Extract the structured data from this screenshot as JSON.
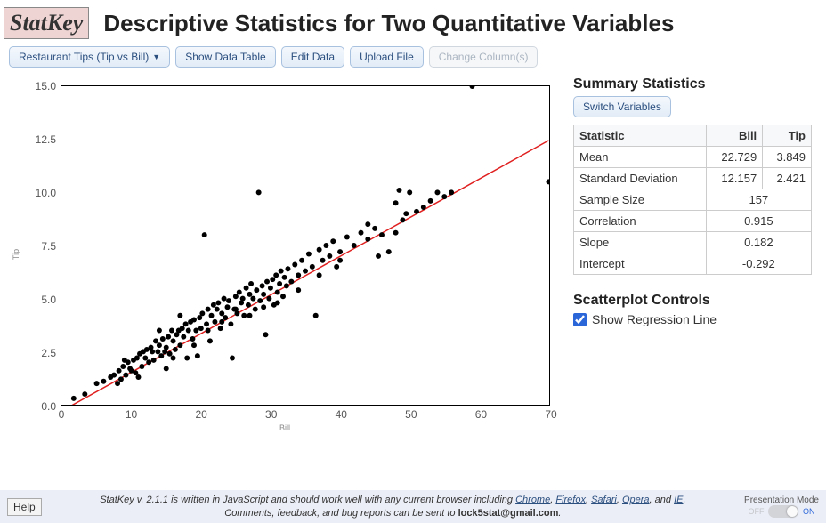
{
  "header": {
    "logo": "StatKey",
    "title": "Descriptive Statistics for Two Quantitative Variables"
  },
  "toolbar": {
    "dataset": "Restaurant Tips (Tip vs Bill)",
    "show_table": "Show Data Table",
    "edit": "Edit Data",
    "upload": "Upload File",
    "change_cols": "Change Column(s)"
  },
  "summary": {
    "title": "Summary Statistics",
    "switch": "Switch Variables",
    "head_stat": "Statistic",
    "head_x": "Bill",
    "head_y": "Tip",
    "rows": {
      "mean_label": "Mean",
      "mean_x": "22.729",
      "mean_y": "3.849",
      "sd_label": "Standard Deviation",
      "sd_x": "12.157",
      "sd_y": "2.421",
      "n_label": "Sample Size",
      "n": "157",
      "r_label": "Correlation",
      "r": "0.915",
      "slope_label": "Slope",
      "slope": "0.182",
      "int_label": "Intercept",
      "int": "-0.292"
    }
  },
  "controls": {
    "title": "Scatterplot Controls",
    "show_reg": "Show Regression Line",
    "show_reg_checked": true
  },
  "footer": {
    "help": "Help",
    "line1a": "StatKey v. 2.1.1 is written in JavaScript and should work well with any current browser including ",
    "chrome": "Chrome",
    "firefox": "Firefox",
    "safari": "Safari",
    "opera": "Opera",
    "ie": "IE",
    "line1b": ".",
    "line2a": "Comments, feedback, and bug reports can be sent to ",
    "email": "lock5stat@gmail.com",
    "line2b": ".",
    "presentation": "Presentation Mode",
    "off": "OFF",
    "on": "ON"
  },
  "chart_data": {
    "type": "scatter",
    "xlabel": "Bill",
    "ylabel": "Tip",
    "xlim": [
      0,
      70
    ],
    "ylim": [
      0,
      15
    ],
    "xticks": [
      0,
      10,
      20,
      30,
      40,
      50,
      60,
      70
    ],
    "yticks": [
      0.0,
      2.5,
      5.0,
      7.5,
      10.0,
      12.5,
      15.0
    ],
    "regression": {
      "slope": 0.182,
      "intercept": -0.292,
      "color": "#e02020"
    },
    "points": [
      [
        1.7,
        0.3
      ],
      [
        3.3,
        0.5
      ],
      [
        5.0,
        1.0
      ],
      [
        6.0,
        1.1
      ],
      [
        7.0,
        1.3
      ],
      [
        7.5,
        1.4
      ],
      [
        8.0,
        1.0
      ],
      [
        8.2,
        1.6
      ],
      [
        8.5,
        1.2
      ],
      [
        8.8,
        1.8
      ],
      [
        9.0,
        2.1
      ],
      [
        9.2,
        1.4
      ],
      [
        9.5,
        2.0
      ],
      [
        9.8,
        1.7
      ],
      [
        10.0,
        1.6
      ],
      [
        10.3,
        2.1
      ],
      [
        10.6,
        1.5
      ],
      [
        10.8,
        2.2
      ],
      [
        11.0,
        1.3
      ],
      [
        11.2,
        2.4
      ],
      [
        11.5,
        1.8
      ],
      [
        11.7,
        2.5
      ],
      [
        12.0,
        2.2
      ],
      [
        12.2,
        2.6
      ],
      [
        12.5,
        2.0
      ],
      [
        12.8,
        2.7
      ],
      [
        13.0,
        2.5
      ],
      [
        13.2,
        2.1
      ],
      [
        13.5,
        3.0
      ],
      [
        13.8,
        2.5
      ],
      [
        14.0,
        2.8
      ],
      [
        14.3,
        2.3
      ],
      [
        14.5,
        3.1
      ],
      [
        14.8,
        2.5
      ],
      [
        15.0,
        2.7
      ],
      [
        15.3,
        3.2
      ],
      [
        15.5,
        2.4
      ],
      [
        15.8,
        3.5
      ],
      [
        16.0,
        3.0
      ],
      [
        16.3,
        2.6
      ],
      [
        16.5,
        3.3
      ],
      [
        16.8,
        3.5
      ],
      [
        17.0,
        2.8
      ],
      [
        17.3,
        3.6
      ],
      [
        17.5,
        3.2
      ],
      [
        17.8,
        3.8
      ],
      [
        18.0,
        2.2
      ],
      [
        18.2,
        3.5
      ],
      [
        18.5,
        3.9
      ],
      [
        18.8,
        3.1
      ],
      [
        19.0,
        4.0
      ],
      [
        19.3,
        3.5
      ],
      [
        19.5,
        2.3
      ],
      [
        19.8,
        4.1
      ],
      [
        20.0,
        3.6
      ],
      [
        20.2,
        4.3
      ],
      [
        20.5,
        8.0
      ],
      [
        20.8,
        3.8
      ],
      [
        21.0,
        4.5
      ],
      [
        21.3,
        3.0
      ],
      [
        21.5,
        4.2
      ],
      [
        21.8,
        4.7
      ],
      [
        22.0,
        3.9
      ],
      [
        22.3,
        4.5
      ],
      [
        22.5,
        4.8
      ],
      [
        22.8,
        3.6
      ],
      [
        23.0,
        4.3
      ],
      [
        23.3,
        5.0
      ],
      [
        23.5,
        4.1
      ],
      [
        23.8,
        4.6
      ],
      [
        24.0,
        4.9
      ],
      [
        24.3,
        3.8
      ],
      [
        24.5,
        2.2
      ],
      [
        24.8,
        4.5
      ],
      [
        25.0,
        5.1
      ],
      [
        25.2,
        4.3
      ],
      [
        25.5,
        5.3
      ],
      [
        25.8,
        4.8
      ],
      [
        26.0,
        5.0
      ],
      [
        26.2,
        4.2
      ],
      [
        26.5,
        5.5
      ],
      [
        26.8,
        4.7
      ],
      [
        27.0,
        5.2
      ],
      [
        27.2,
        5.7
      ],
      [
        27.5,
        5.0
      ],
      [
        27.8,
        4.5
      ],
      [
        28.0,
        5.4
      ],
      [
        28.3,
        10.0
      ],
      [
        28.5,
        4.9
      ],
      [
        28.8,
        5.6
      ],
      [
        29.0,
        5.2
      ],
      [
        29.3,
        3.3
      ],
      [
        29.5,
        5.8
      ],
      [
        29.8,
        5.0
      ],
      [
        30.0,
        5.5
      ],
      [
        30.3,
        5.9
      ],
      [
        30.5,
        4.7
      ],
      [
        30.8,
        6.1
      ],
      [
        31.0,
        5.3
      ],
      [
        31.3,
        5.7
      ],
      [
        31.5,
        6.3
      ],
      [
        31.8,
        5.1
      ],
      [
        32.0,
        6.0
      ],
      [
        32.3,
        5.6
      ],
      [
        32.5,
        6.4
      ],
      [
        33.0,
        5.8
      ],
      [
        33.5,
        6.6
      ],
      [
        34.0,
        6.1
      ],
      [
        34.5,
        6.8
      ],
      [
        35.0,
        6.3
      ],
      [
        35.5,
        7.1
      ],
      [
        36.0,
        6.5
      ],
      [
        36.5,
        4.2
      ],
      [
        37.0,
        7.3
      ],
      [
        37.5,
        6.8
      ],
      [
        38.0,
        7.5
      ],
      [
        38.5,
        7.0
      ],
      [
        39.0,
        7.7
      ],
      [
        39.5,
        6.5
      ],
      [
        40.0,
        7.2
      ],
      [
        41.0,
        7.9
      ],
      [
        42.0,
        7.5
      ],
      [
        43.0,
        8.1
      ],
      [
        44.0,
        7.8
      ],
      [
        45.0,
        8.3
      ],
      [
        45.5,
        7.0
      ],
      [
        46.0,
        8.0
      ],
      [
        47.0,
        7.2
      ],
      [
        48.0,
        9.5
      ],
      [
        48.5,
        10.1
      ],
      [
        49.0,
        8.7
      ],
      [
        49.5,
        9.0
      ],
      [
        50.0,
        10.0
      ],
      [
        52.0,
        9.3
      ],
      [
        53.0,
        9.6
      ],
      [
        54.0,
        10.0
      ],
      [
        55.0,
        9.8
      ],
      [
        56.0,
        10.0
      ],
      [
        59.0,
        15.0
      ],
      [
        70.0,
        10.5
      ],
      [
        15.0,
        1.7
      ],
      [
        17.0,
        4.2
      ],
      [
        19.0,
        2.8
      ],
      [
        21.0,
        3.5
      ],
      [
        23.0,
        3.9
      ],
      [
        25.0,
        4.5
      ],
      [
        27.0,
        4.2
      ],
      [
        29.0,
        4.6
      ],
      [
        31.0,
        4.8
      ],
      [
        34.0,
        5.4
      ],
      [
        37.0,
        6.1
      ],
      [
        40.0,
        6.8
      ],
      [
        44.0,
        8.5
      ],
      [
        48.0,
        8.1
      ],
      [
        51.0,
        9.1
      ],
      [
        14.0,
        3.5
      ],
      [
        16.0,
        2.2
      ]
    ]
  }
}
